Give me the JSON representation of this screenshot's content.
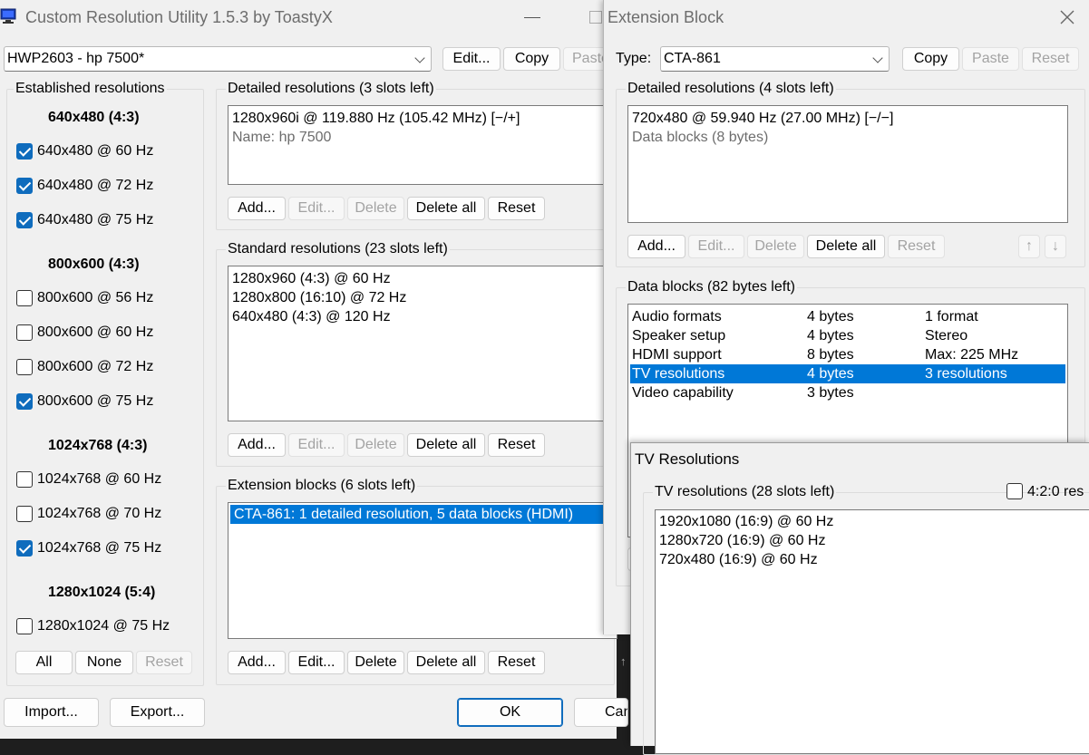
{
  "main": {
    "title": "Custom Resolution Utility 1.5.3 by ToastyX",
    "monitor_select": "HWP2603 - hp 7500*",
    "edit_button": "Edit...",
    "copy_button": "Copy",
    "paste_button": "Paste",
    "established": {
      "title": "Established resolutions",
      "groups": [
        {
          "header": "640x480 (4:3)",
          "items": [
            {
              "label": "640x480 @ 60 Hz",
              "checked": true
            },
            {
              "label": "640x480 @ 72 Hz",
              "checked": true
            },
            {
              "label": "640x480 @ 75 Hz",
              "checked": true
            }
          ]
        },
        {
          "header": "800x600 (4:3)",
          "items": [
            {
              "label": "800x600 @ 56 Hz",
              "checked": false
            },
            {
              "label": "800x600 @ 60 Hz",
              "checked": false
            },
            {
              "label": "800x600 @ 72 Hz",
              "checked": false
            },
            {
              "label": "800x600 @ 75 Hz",
              "checked": true
            }
          ]
        },
        {
          "header": "1024x768 (4:3)",
          "items": [
            {
              "label": "1024x768 @ 60 Hz",
              "checked": false
            },
            {
              "label": "1024x768 @ 70 Hz",
              "checked": false
            },
            {
              "label": "1024x768 @ 75 Hz",
              "checked": true
            }
          ]
        },
        {
          "header": "1280x1024 (5:4)",
          "items": [
            {
              "label": "1280x1024 @ 75 Hz",
              "checked": false
            }
          ]
        }
      ],
      "all_button": "All",
      "none_button": "None",
      "reset_button": "Reset"
    },
    "detailed": {
      "title": "Detailed resolutions (3 slots left)",
      "line1": "1280x960i @ 119.880 Hz (105.42 MHz) [−/+]",
      "line2": "Name: hp 7500"
    },
    "standard": {
      "title": "Standard resolutions (23 slots left)",
      "items": [
        "1280x960 (4:3) @ 60 Hz",
        "1280x800 (16:10) @ 72 Hz",
        "640x480 (4:3) @ 120 Hz"
      ]
    },
    "extension": {
      "title": "Extension blocks (6 slots left)",
      "selected_item": "CTA-861: 1 detailed resolution, 5 data blocks (HDMI)"
    },
    "buttons": {
      "add": "Add...",
      "edit": "Edit...",
      "delete": "Delete",
      "delete_all": "Delete all",
      "reset": "Reset"
    },
    "import_button": "Import...",
    "export_button": "Export...",
    "ok_button": "OK",
    "cancel_button": "Canc"
  },
  "ext_block": {
    "title": "Extension Block",
    "type_label": "Type:",
    "type_value": "CTA-861",
    "copy_button": "Copy",
    "paste_button": "Paste",
    "reset_button": "Reset",
    "detailed": {
      "title": "Detailed resolutions (4 slots left)",
      "line1": "720x480 @ 59.940 Hz (27.00 MHz) [−/−]",
      "line2": "Data blocks (8 bytes)"
    },
    "data_blocks": {
      "title": "Data blocks (82 bytes left)",
      "rows": [
        {
          "name": "Audio formats",
          "size": "4 bytes",
          "info": "1 format",
          "selected": false
        },
        {
          "name": "Speaker setup",
          "size": "4 bytes",
          "info": "Stereo",
          "selected": false
        },
        {
          "name": "HDMI support",
          "size": "8 bytes",
          "info": "Max: 225 MHz",
          "selected": false
        },
        {
          "name": "TV resolutions",
          "size": "4 bytes",
          "info": "3 resolutions",
          "selected": true
        },
        {
          "name": "Video capability",
          "size": "3 bytes",
          "info": "",
          "selected": false
        }
      ]
    }
  },
  "tv_res": {
    "title": "TV Resolutions",
    "group_title": "TV resolutions (28 slots left)",
    "checkbox_420": "4:2:0 res",
    "items": [
      "1920x1080 (16:9) @ 60 Hz",
      "1280x720 (16:9) @ 60 Hz",
      "720x480 (16:9) @ 60 Hz"
    ]
  },
  "colors": {
    "accent": "#0f6cbd",
    "selection": "#0078d7"
  }
}
